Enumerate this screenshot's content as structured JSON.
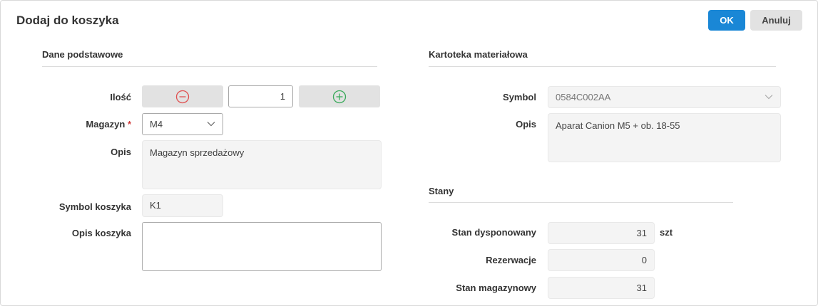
{
  "dialog": {
    "title": "Dodaj do koszyka",
    "ok_label": "OK",
    "cancel_label": "Anuluj"
  },
  "basic": {
    "section_title": "Dane podstawowe",
    "qty_label": "Ilość",
    "qty_value": "1",
    "warehouse_label": "Magazyn",
    "required_mark": "*",
    "warehouse_value": "M4",
    "desc_label": "Opis",
    "desc_value": "Magazyn sprzedażowy",
    "cart_symbol_label": "Symbol koszyka",
    "cart_symbol_value": "K1",
    "cart_desc_label": "Opis koszyka",
    "cart_desc_value": ""
  },
  "material": {
    "section_title": "Kartoteka materiałowa",
    "symbol_label": "Symbol",
    "symbol_value": "0584C002AA",
    "desc_label": "Opis",
    "desc_value": "Aparat Canion M5 + ob. 18-55"
  },
  "stock": {
    "section_title": "Stany",
    "available_label": "Stan dysponowany",
    "available_value": "31",
    "unit": "szt",
    "reservations_label": "Rezerwacje",
    "reservations_value": "0",
    "warehouse_stock_label": "Stan magazynowy",
    "warehouse_stock_value": "31"
  },
  "icons": {
    "minus": "minus-circle-icon",
    "plus": "plus-circle-icon",
    "dropdown": "chevron-down-icon"
  },
  "colors": {
    "primary": "#1a87d6",
    "minus": "#e05252",
    "plus": "#3aaa5b",
    "required": "#d03a3a"
  }
}
